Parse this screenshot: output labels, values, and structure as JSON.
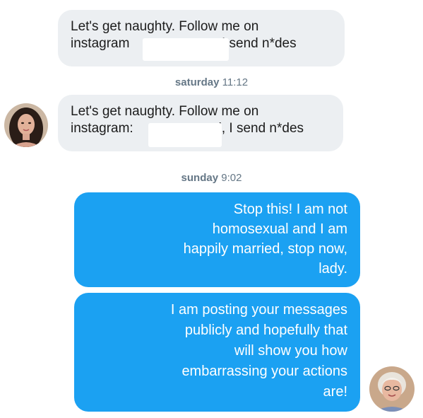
{
  "messages": {
    "m1": {
      "line1": "Let's get naughty. Follow me on",
      "line2a": "instagram",
      "line2b": "I send n*des"
    },
    "m2": {
      "line1": "Let's get naughty. Follow me on",
      "line2a": "instagram:",
      "line2b": "d, I send n*des"
    },
    "m3": {
      "lines": [
        "Stop this! I am not",
        "homosexual and I am",
        "happily married, stop now,",
        "lady."
      ]
    },
    "m4": {
      "lines": [
        "I am posting your messages",
        "publicly and hopefully that",
        "will show you how",
        "embarrassing your actions",
        "are!"
      ]
    }
  },
  "timestamps": {
    "t1": {
      "day": "saturday",
      "time": "11:12"
    },
    "t2": {
      "day": "sunday",
      "time": "9:02"
    }
  },
  "colors": {
    "incoming_bubble": "#eceff2",
    "outgoing_bubble": "#1ba1f2",
    "timestamp": "#657786"
  }
}
